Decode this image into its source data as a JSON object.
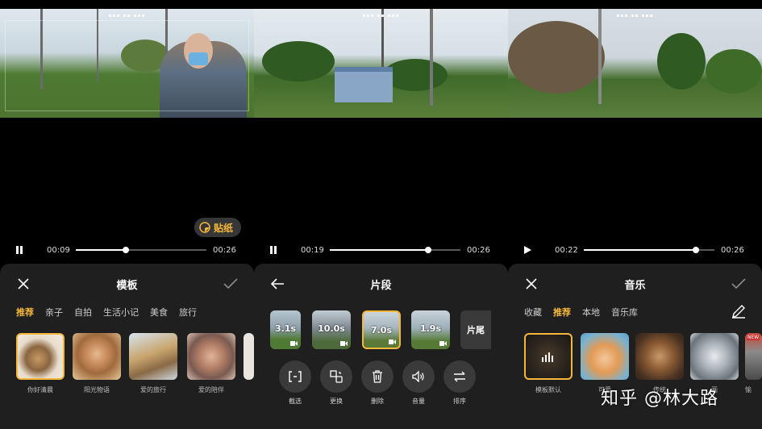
{
  "p1": {
    "sticker_label": "贴纸",
    "current_time": "00:09",
    "total_time": "00:26",
    "progress": 0.38,
    "title": "模板",
    "tabs": [
      "推荐",
      "亲子",
      "自拍",
      "生活小记",
      "美食",
      "旅行"
    ],
    "templates": [
      "你好清晨",
      "阳光物语",
      "爱的旅行",
      "爱的陪伴"
    ]
  },
  "p2": {
    "current_time": "00:19",
    "total_time": "00:26",
    "progress": 0.75,
    "title": "片段",
    "clips": [
      "3.1s",
      "10.0s",
      "7.0s",
      "1.9s"
    ],
    "ending_label": "片尾",
    "tools": [
      "截选",
      "更换",
      "删除",
      "音量",
      "排序"
    ]
  },
  "p3": {
    "current_time": "00:22",
    "total_time": "00:26",
    "progress": 0.86,
    "title": "音乐",
    "tabs": [
      "收藏",
      "推荐",
      "本地",
      "音乐库"
    ],
    "music": [
      "模板默认",
      "可爱",
      "传统",
      "画",
      "愉"
    ],
    "new_badge": "NEW"
  },
  "watermark": "知乎 @林大路",
  "colors": {
    "accent": "#f5b73b",
    "sheet_bg": "#1f1f1f",
    "button_bg": "#3a3a3a"
  }
}
